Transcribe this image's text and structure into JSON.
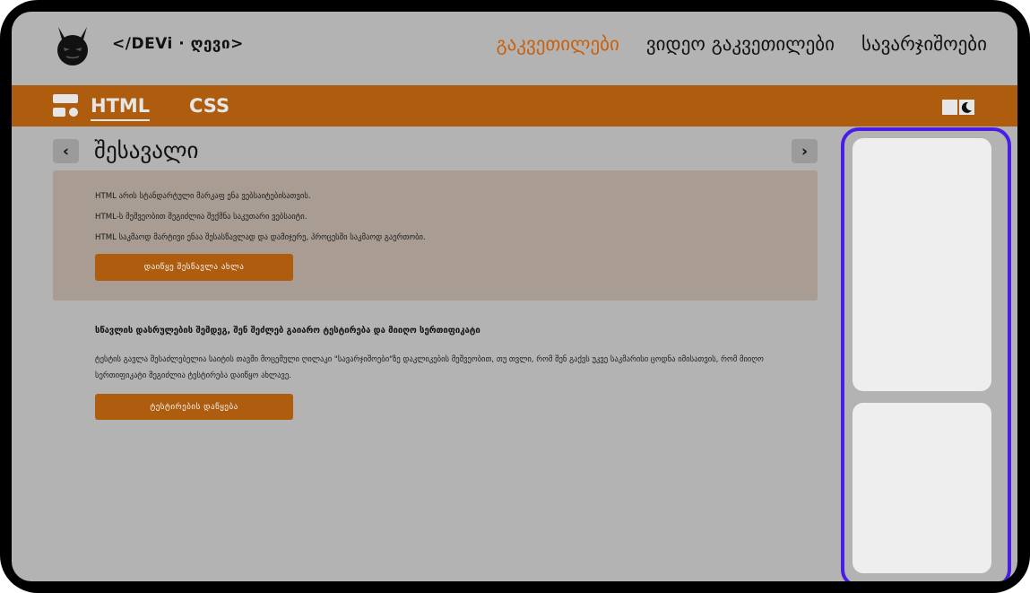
{
  "brand": {
    "name": "</DEVi · ღევი>"
  },
  "nav": {
    "items": [
      {
        "label": "გაკვეთილები",
        "active": true
      },
      {
        "label": "ვიდეო გაკვეთილები",
        "active": false
      },
      {
        "label": "სავარჯიშოები",
        "active": false
      }
    ]
  },
  "tabs": {
    "html": "HTML",
    "css": "CSS"
  },
  "colors": {
    "accent": "#ad5d0d",
    "active_menu": "#c8610d",
    "ad_border": "#4a1de6",
    "background": "#b3b3b3"
  },
  "page": {
    "title": "შესავალი",
    "prev_icon": "chevron-left-icon",
    "next_icon": "chevron-right-icon"
  },
  "intro": {
    "lines": [
      "HTML არის სტანდარტული მარკაფ ენა ვებსაიტებისათვის.",
      "HTML-ს მეშვეობით შეგიძლია შექმნა საკუთარი ვებსაიტი.",
      "HTML საკმაოდ მარტივი ენაა შესასწავლად და დამიჯერე, პროცესში საკმაოდ გაერთობი."
    ],
    "start_button": "დაიწყე შესწავლა ახლა"
  },
  "test": {
    "title": "სწავლის დასრულების შემდეგ, შენ შეძლებ გაიარო ტესტირება და მიიღო სერთიფიკატი",
    "text": "ტესტის გავლა შესაძლებელია საიტის თავში მოცემული ღილაკი \"სავარჯიშოები\"ზე დაკლიკების მეშვეობით, თუ თვლი, რომ შენ გაქვს უკვე საკმარისი ცოდნა იმისათვის, რომ მიიღო სერთიფიკატი შეგიძლია ტესტირება დაიწყო ახლავე.",
    "button": "ტესტირების დაწყება"
  }
}
